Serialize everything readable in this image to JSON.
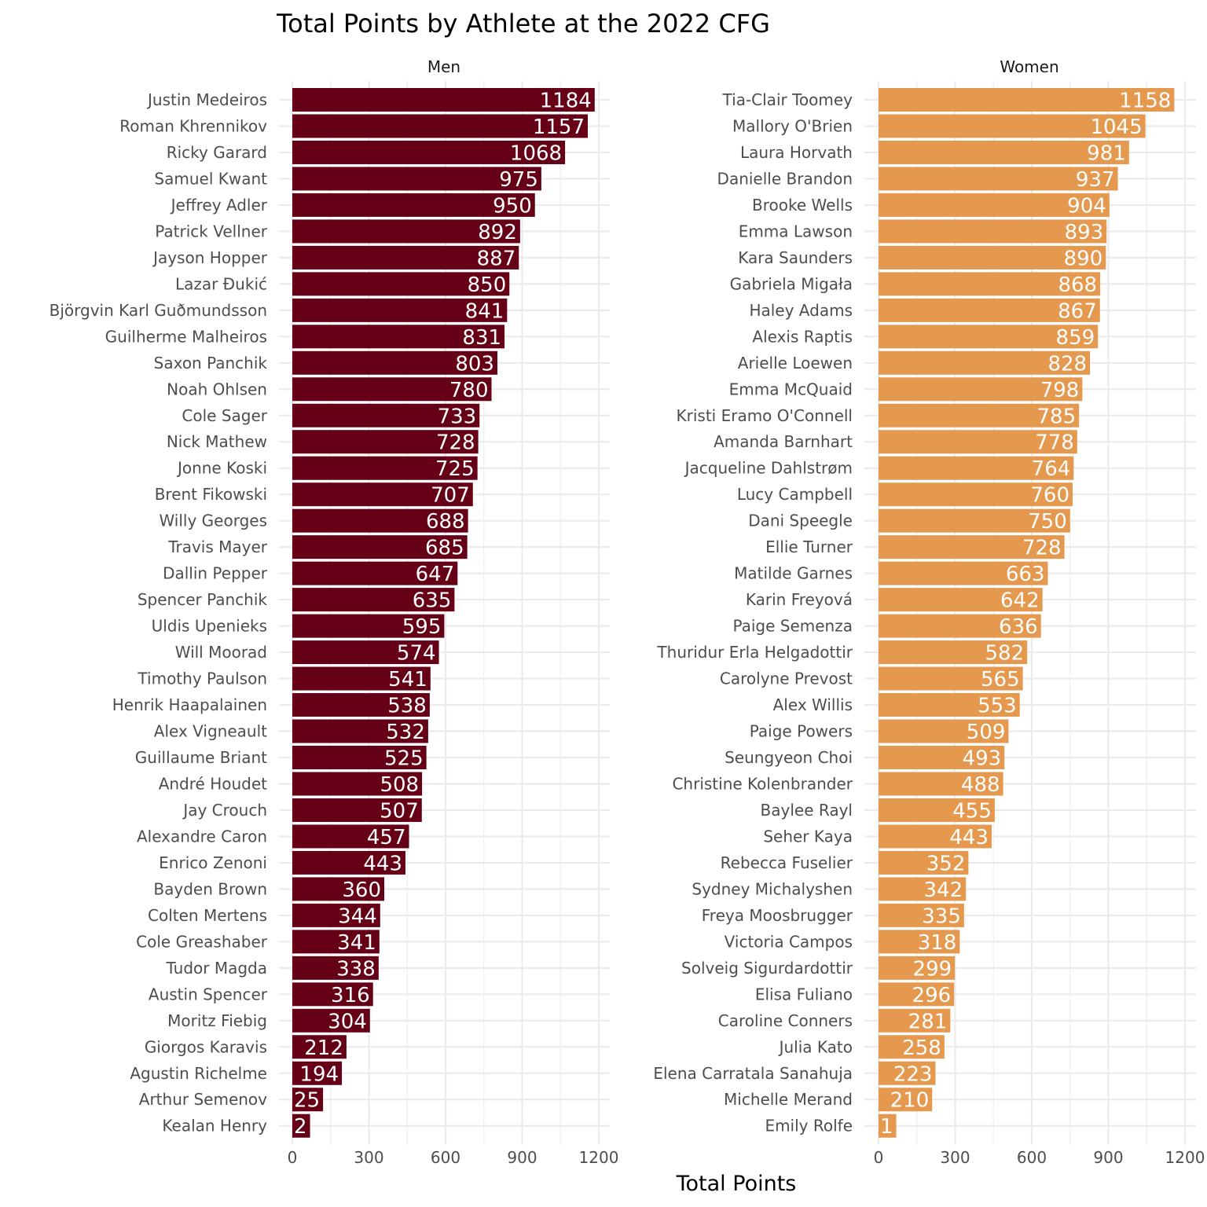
{
  "chart_data": {
    "type": "bar",
    "orientation": "horizontal",
    "title": "Total Points by Athlete at the 2022 CFG",
    "xlabel": "Total Points",
    "ylabel": "",
    "xlim": [
      0,
      1200
    ],
    "x_ticks": [
      "0",
      "300",
      "600",
      "900",
      "1200"
    ],
    "x_tick_values": [
      0,
      300,
      600,
      900,
      1200
    ],
    "grid": true,
    "facets": [
      {
        "name": "Men",
        "color": "#660016",
        "categories": [
          "Justin Medeiros",
          "Roman Khrennikov",
          "Ricky Garard",
          "Samuel Kwant",
          "Jeffrey Adler",
          "Patrick Vellner",
          "Jayson Hopper",
          "Lazar Đukić",
          "Björgvin Karl Guðmundsson",
          "Guilherme Malheiros",
          "Saxon Panchik",
          "Noah Ohlsen",
          "Cole Sager",
          "Nick Mathew",
          "Jonne Koski",
          "Brent Fikowski",
          "Willy Georges",
          "Travis Mayer",
          "Dallin Pepper",
          "Spencer Panchik",
          "Uldis Upenieks",
          "Will Moorad",
          "Timothy Paulson",
          "Henrik Haapalainen",
          "Alex Vigneault",
          "Guillaume Briant",
          "André Houdet",
          "Jay Crouch",
          "Alexandre Caron",
          "Enrico Zenoni",
          "Bayden Brown",
          "Colten Mertens",
          "Cole Greashaber",
          "Tudor Magda",
          "Austin Spencer",
          "Moritz Fiebig",
          "Giorgos Karavis",
          "Agustin Richelme",
          "Arthur Semenov",
          "Kealan Henry"
        ],
        "values": [
          1184,
          1157,
          1068,
          975,
          950,
          892,
          887,
          850,
          841,
          831,
          803,
          780,
          733,
          728,
          725,
          707,
          688,
          685,
          647,
          635,
          595,
          574,
          541,
          538,
          532,
          525,
          508,
          507,
          457,
          443,
          360,
          344,
          341,
          338,
          316,
          304,
          212,
          194,
          25,
          2
        ]
      },
      {
        "name": "Women",
        "color": "#E5994F",
        "categories": [
          "Tia-Clair Toomey",
          "Mallory O'Brien",
          "Laura Horvath",
          "Danielle Brandon",
          "Brooke Wells",
          "Emma Lawson",
          "Kara Saunders",
          "Gabriela Migała",
          "Haley Adams",
          "Alexis Raptis",
          "Arielle Loewen",
          "Emma McQuaid",
          "Kristi Eramo O'Connell",
          "Amanda Barnhart",
          "Jacqueline Dahlstrøm",
          "Lucy Campbell",
          "Dani Speegle",
          "Ellie Turner",
          "Matilde Garnes",
          "Karin Freyová",
          "Paige Semenza",
          "Thuridur Erla Helgadottir",
          "Carolyne Prevost",
          "Alex Willis",
          "Paige Powers",
          "Seungyeon Choi",
          "Christine Kolenbrander",
          "Baylee Rayl",
          "Seher Kaya",
          "Rebecca Fuselier",
          "Sydney Michalyshen",
          "Freya Moosbrugger",
          "Victoria Campos",
          "Solveig Sigurdardottir",
          "Elisa Fuliano",
          "Caroline Conners",
          "Julia Kato",
          "Elena Carratala Sanahuja",
          "Michelle Merand",
          "Emily Rolfe"
        ],
        "values": [
          1158,
          1045,
          981,
          937,
          904,
          893,
          890,
          868,
          867,
          859,
          828,
          798,
          785,
          778,
          764,
          760,
          750,
          728,
          663,
          642,
          636,
          582,
          565,
          553,
          509,
          493,
          488,
          455,
          443,
          352,
          342,
          335,
          318,
          299,
          296,
          281,
          258,
          223,
          210,
          1
        ]
      }
    ]
  }
}
